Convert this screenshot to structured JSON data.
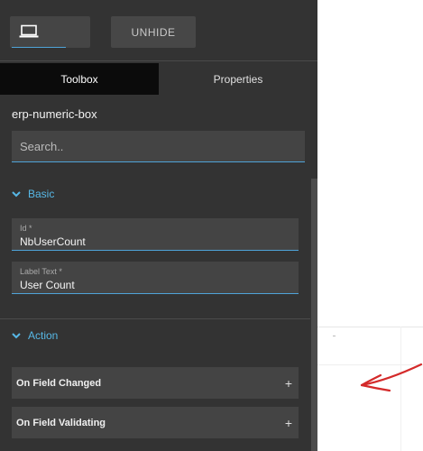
{
  "toolbar": {
    "device_icon": "laptop-icon",
    "unhide_label": "UNHIDE"
  },
  "tabs": [
    {
      "label": "Toolbox",
      "active": true
    },
    {
      "label": "Properties",
      "active": false
    }
  ],
  "component": {
    "name": "erp-numeric-box"
  },
  "search": {
    "placeholder": "Search.."
  },
  "sections": {
    "basic": {
      "title": "Basic",
      "fields": [
        {
          "label": "Id *",
          "value": "NbUserCount"
        },
        {
          "label": "Label Text *",
          "value": "User Count"
        }
      ]
    },
    "action": {
      "title": "Action",
      "events": [
        {
          "label": "On Field Changed",
          "icon": "plus-icon"
        },
        {
          "label": "On Field Validating",
          "icon": "plus-icon"
        }
      ]
    }
  },
  "colors": {
    "panel_bg": "#333333",
    "accent": "#57b8e6",
    "annotation_arrow": "#d42a2a"
  }
}
